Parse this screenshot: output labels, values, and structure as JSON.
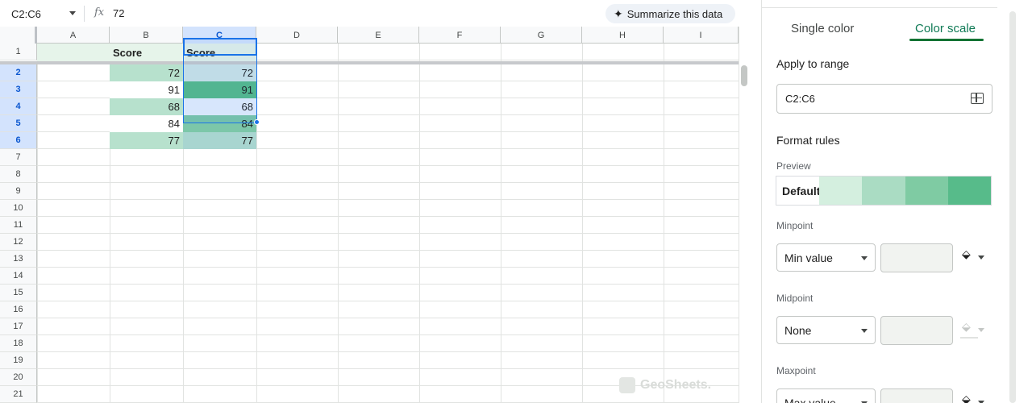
{
  "formula_bar": {
    "name_box": "C2:C6",
    "fx_icon": "function-icon",
    "formula": "72",
    "summarize_icon": "sparkle-icon",
    "summarize_label": "Summarize this data"
  },
  "grid": {
    "columns": [
      "A",
      "B",
      "C",
      "D",
      "E",
      "F",
      "G",
      "H",
      "I"
    ],
    "selected_column": "C",
    "rows": [
      "1",
      "2",
      "3",
      "4",
      "5",
      "6",
      "7",
      "8",
      "9",
      "10",
      "11",
      "12",
      "13",
      "14",
      "15",
      "16",
      "17",
      "18",
      "19",
      "20",
      "21"
    ],
    "selected_rows": [
      "2",
      "3",
      "4",
      "5",
      "6"
    ],
    "header_row": {
      "B": "Score",
      "C": "Score"
    },
    "values_b": [
      "72",
      "91",
      "68",
      "84",
      "77"
    ],
    "values_c": [
      "72",
      "91",
      "68",
      "84",
      "77"
    ],
    "colors_b": [
      "#b7e1cd",
      "#ffffff",
      "#b7e1cd",
      "#ffffff",
      "#b7e1cd"
    ],
    "colors_c": [
      "#cfe5e8",
      "#57bb8a",
      "#e8f0fe",
      "#7cc7a9",
      "#a8d5d0"
    ],
    "header_fill": "#e6f4ea"
  },
  "watermark": "GeoSheets.",
  "panel": {
    "tabs": [
      "Single color",
      "Color scale"
    ],
    "active_tab": "Color scale",
    "apply_range_label": "Apply to range",
    "range_value": "C2:C6",
    "range_icon": "select-range-icon",
    "format_rules_label": "Format rules",
    "preview_label": "Preview",
    "preview_default": "Default",
    "preview_colors": [
      "#d4efdf",
      "#aadcc3",
      "#7fcba3",
      "#57bb8a"
    ],
    "minpoint_label": "Minpoint",
    "minpoint_type": "Min value",
    "midpoint_label": "Midpoint",
    "midpoint_type": "None",
    "maxpoint_label": "Maxpoint",
    "maxpoint_type": "Max value",
    "fill_icon": "fill-color-icon"
  },
  "colors": {
    "accent": "#1a73e8",
    "panel_accent": "#137333"
  }
}
